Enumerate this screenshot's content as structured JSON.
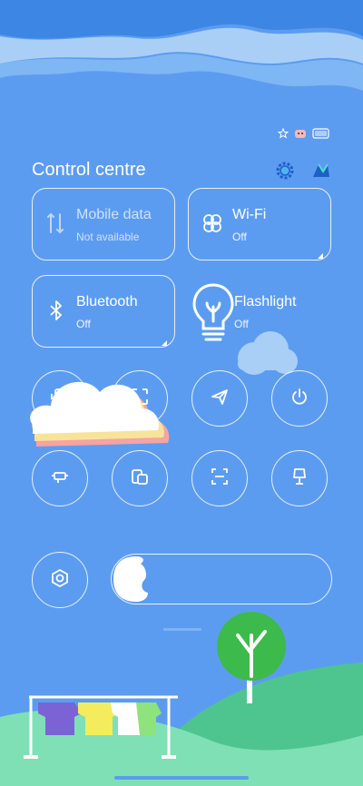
{
  "header": {
    "title": "Control centre",
    "settings_icon": "gear-icon",
    "edit_icon": "edit-icon"
  },
  "status_bar": {
    "icons": [
      "star-icon",
      "cat-icon",
      "battery-icon"
    ]
  },
  "tiles": {
    "mobile_data": {
      "label": "Mobile data",
      "status": "Not available",
      "icon": "mobile-data-icon"
    },
    "wifi": {
      "label": "Wi-Fi",
      "status": "Off",
      "icon": "wifi-clover-icon"
    },
    "bluetooth": {
      "label": "Bluetooth",
      "status": "Off",
      "icon": "bluetooth-icon"
    },
    "flashlight": {
      "label": "Flashlight",
      "status": "Off",
      "icon": "lightbulb-icon"
    }
  },
  "toggles": [
    "vibrate-icon",
    "screenshot-icon",
    "airplane-icon",
    "power-icon",
    "cast-icon",
    "floating-window-icon",
    "scan-icon",
    "lamp-icon"
  ],
  "brightness": {
    "auto_icon": "auto-brightness-icon",
    "level": 0.15
  },
  "colors": {
    "background": "#5c9cf0",
    "wave_light": "#a9cff7",
    "hill_green": "#63d8a2",
    "tree_green": "#3dba4c"
  }
}
